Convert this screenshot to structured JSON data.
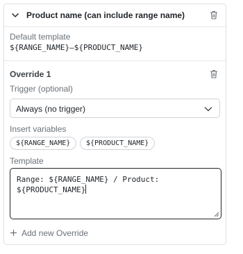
{
  "section": {
    "title": "Product name (can include range name)",
    "default_template_label": "Default template",
    "default_template_value": "${RANGE_NAME}–${PRODUCT_NAME}"
  },
  "override": {
    "title": "Override 1",
    "trigger_label": "Trigger (optional)",
    "trigger_value": "Always (no trigger)",
    "insert_label": "Insert variables",
    "variables": [
      "${RANGE_NAME}",
      "${PRODUCT_NAME}"
    ],
    "template_label": "Template",
    "template_value": "Range: ${RANGE_NAME} / Product:\n${PRODUCT_NAME}"
  },
  "actions": {
    "add_override_label": "Add new Override"
  },
  "icons": {
    "collapse": "chevron-down-icon",
    "delete": "trash-icon",
    "dropdown": "chevron-down-icon",
    "add": "plus-icon"
  }
}
